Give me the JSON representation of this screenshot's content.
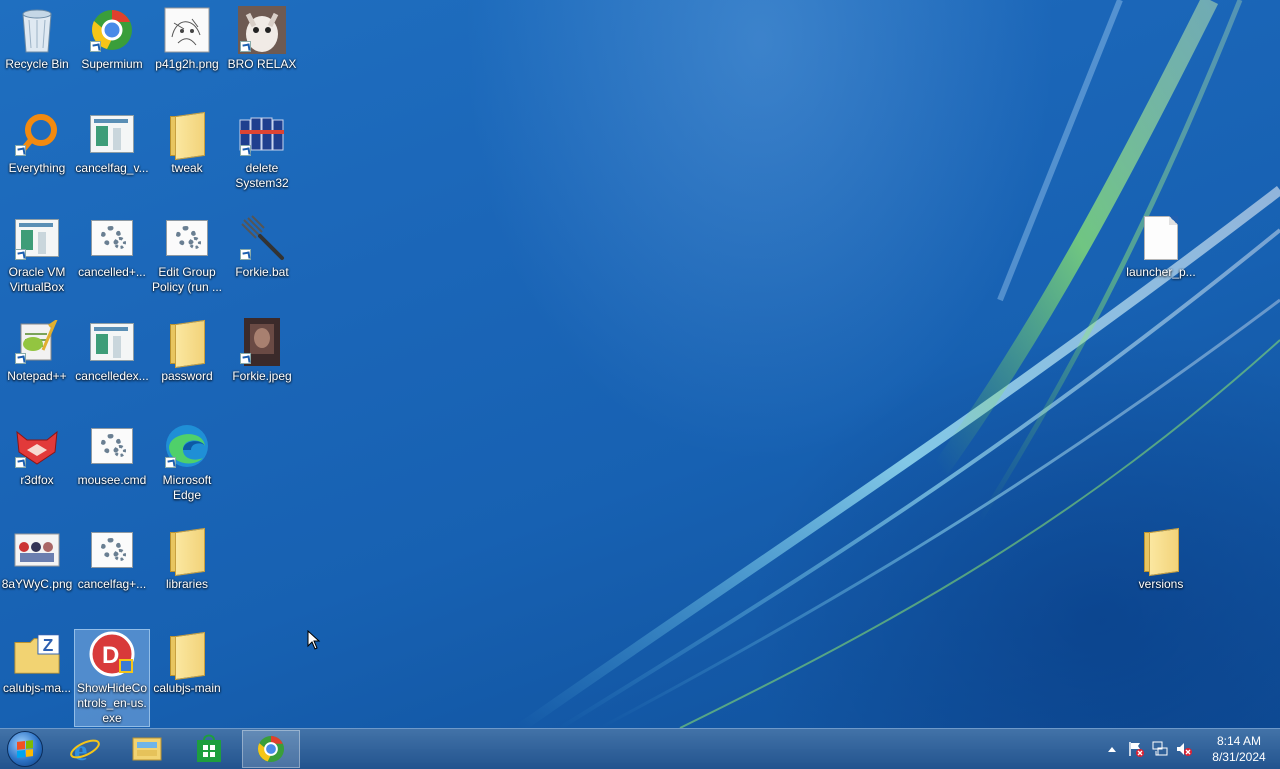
{
  "desktop": {
    "icons": [
      {
        "label": "Recycle Bin",
        "icon": "recycle-bin-icon"
      },
      {
        "label": "Supermium",
        "icon": "supermium-browser-icon"
      },
      {
        "label": "p41g2h.png",
        "icon": "image-file-icon"
      },
      {
        "label": "BRO RELAX",
        "icon": "photo-shortcut-icon"
      },
      {
        "label": "Everything",
        "icon": "everything-search-icon"
      },
      {
        "label": "cancelfag_v...",
        "icon": "application-icon"
      },
      {
        "label": "tweak",
        "icon": "folder-icon"
      },
      {
        "label": "delete System32",
        "icon": "cans-image-icon"
      },
      {
        "label": "Oracle VM VirtualBox",
        "icon": "virtualbox-icon"
      },
      {
        "label": "cancelled+...",
        "icon": "batch-file-icon"
      },
      {
        "label": "Edit Group Policy (run ...",
        "icon": "batch-file-icon"
      },
      {
        "label": "Forkie.bat",
        "icon": "fork-icon"
      },
      {
        "label": "Notepad++",
        "icon": "notepadplusplus-icon"
      },
      {
        "label": "cancelledex...",
        "icon": "application-icon"
      },
      {
        "label": "password",
        "icon": "folder-icon"
      },
      {
        "label": "Forkie.jpeg",
        "icon": "photo-shortcut-icon"
      },
      {
        "label": "r3dfox",
        "icon": "r3dfox-browser-icon"
      },
      {
        "label": "mousee.cmd",
        "icon": "batch-file-icon"
      },
      {
        "label": "Microsoft Edge",
        "icon": "edge-browser-icon"
      },
      {
        "label": "8aYWyC.png",
        "icon": "image-file-icon"
      },
      {
        "label": "cancelfag+...",
        "icon": "batch-file-icon"
      },
      {
        "label": "libraries",
        "icon": "folder-icon"
      },
      {
        "label": "calubjs-ma...",
        "icon": "zip-folder-icon"
      },
      {
        "label": "ShowHideControls_en-us.exe",
        "icon": "setup-exe-icon"
      },
      {
        "label": "calubjs-main",
        "icon": "folder-icon"
      },
      {
        "label": "launcher_p...",
        "icon": "blank-file-icon"
      },
      {
        "label": "versions",
        "icon": "folder-icon"
      }
    ]
  },
  "taskbar": {
    "start_label": "Start",
    "pinned": [
      {
        "icon": "internet-explorer-icon",
        "active": false
      },
      {
        "icon": "file-explorer-icon",
        "active": false
      },
      {
        "icon": "store-icon",
        "active": false
      },
      {
        "icon": "supermium-browser-icon",
        "active": true
      }
    ],
    "tray": {
      "icons": [
        "show-hidden-icons-chevron",
        "action-center-flag-icon",
        "network-icon",
        "volume-muted-icon"
      ],
      "time": "8:14 AM",
      "date": "8/31/2024"
    }
  },
  "colors": {
    "wallpaper": "#1b66b8",
    "taskbar": "#2a5f9a",
    "accent_green": "#7ee04a",
    "accent_cyan": "#7fe8ff"
  }
}
